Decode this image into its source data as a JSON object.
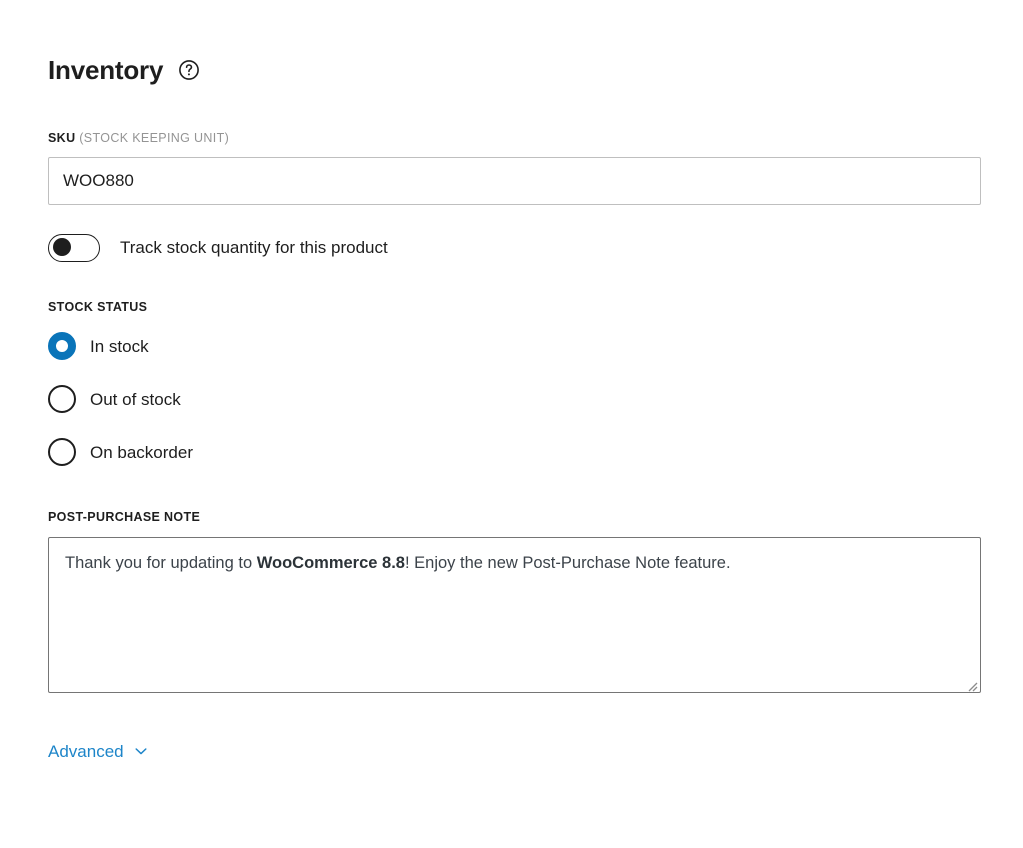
{
  "section": {
    "title": "Inventory",
    "help_icon": "help-circle-icon"
  },
  "sku": {
    "label": "SKU",
    "label_hint": "(STOCK KEEPING UNIT)",
    "value": "WOO880",
    "placeholder": ""
  },
  "track_stock": {
    "label": "Track stock quantity for this product",
    "state": "off"
  },
  "stock_status": {
    "label": "STOCK STATUS",
    "selected": "In stock",
    "options": [
      {
        "label": "In stock",
        "checked": true
      },
      {
        "label": "Out of stock",
        "checked": false
      },
      {
        "label": "On backorder",
        "checked": false
      }
    ]
  },
  "post_purchase_note": {
    "label": "POST-PURCHASE NOTE",
    "text_before": "Thank you for updating to ",
    "text_bold": "WooCommerce 8.8",
    "text_after": "! Enjoy the new Post-Purchase Note feature.",
    "full_text": "Thank you for updating to WooCommerce 8.8! Enjoy the new Post-Purchase Note feature.",
    "placeholder": ""
  },
  "advanced": {
    "label": "Advanced",
    "chevron_icon": "chevron-down-icon",
    "expanded": false
  },
  "colors": {
    "accent_blue": "#0a74b9",
    "link_blue": "#1d85c9",
    "text": "#1e1e1e",
    "muted": "#949494",
    "border": "#bfbfbf",
    "textarea_border": "#757575"
  }
}
